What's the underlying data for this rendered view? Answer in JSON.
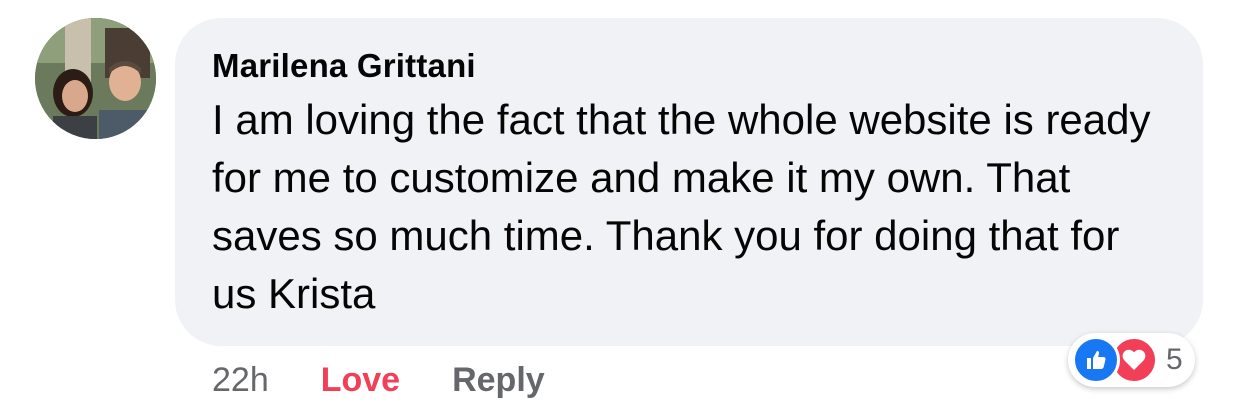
{
  "comment": {
    "author": "Marilena Grittani",
    "text": "I am loving the fact that the whole website is ready for me to customize and make it my own. That saves so much time. Thank you for doing that for us Krista",
    "timestamp": "22h",
    "love_label": "Love",
    "reply_label": "Reply",
    "reaction_count": "5"
  },
  "reactions": [
    "like-icon",
    "love-icon"
  ],
  "colors": {
    "bubble_bg": "#f0f2f5",
    "love": "#f33e58",
    "like": "#1877f2",
    "secondary_text": "#65676b"
  }
}
